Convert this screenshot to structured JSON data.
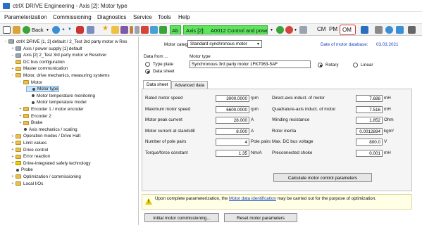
{
  "window": {
    "title": "ctrlX DRIVE Engineering - Axis [2]: Motor type"
  },
  "menu": [
    "Parameterization",
    "Commissioning",
    "Diagnostics",
    "Service",
    "Tools",
    "Help"
  ],
  "toolbar": {
    "back_label": "Back",
    "axis_label": "Axis [2]:",
    "axis_mode": "A0012 Control and power",
    "ab_label": "Ab",
    "cm_label": "CM",
    "pm_label": "PM",
    "om_label": "OM",
    "axis_color": "#5ce65c",
    "highlight_color": "#e0302b"
  },
  "tree": {
    "rows": [
      {
        "label": "ctrlX DRIVE [1, 2] default / 2_Test 3rd party motor w Res",
        "level": 0,
        "icon": "drive-icon",
        "expander": "−"
      },
      {
        "label": "Axis / power supply [1] default",
        "level": 1,
        "icon": "axis-icon",
        "expander": "+"
      },
      {
        "label": "Axis [2] 2_Test 3rd party motor w Resolver",
        "level": 1,
        "icon": "axis-icon",
        "expander": "−"
      },
      {
        "label": "DC bus configuration",
        "level": 2,
        "icon": "folder-icon",
        "expander": ""
      },
      {
        "label": "Master communication",
        "level": 2,
        "icon": "folder-icon",
        "expander": "+"
      },
      {
        "label": "Motor, drive mechanics, measuring systems",
        "level": 2,
        "icon": "folder-icon",
        "expander": "−"
      },
      {
        "label": "Motor",
        "level": 3,
        "icon": "folder-icon",
        "expander": "−"
      },
      {
        "label": "Motor type",
        "level": 4,
        "icon": "bullet-icon",
        "expander": "",
        "selected": true
      },
      {
        "label": "Motor temperature monitoring",
        "level": 4,
        "icon": "bullet-icon",
        "expander": ""
      },
      {
        "label": "Motor temperature model",
        "level": 4,
        "icon": "bullet-icon",
        "expander": ""
      },
      {
        "label": "Encoder 1 / motor encoder",
        "level": 3,
        "icon": "folder-icon",
        "expander": "+"
      },
      {
        "label": "Encoder 2",
        "level": 3,
        "icon": "folder-icon",
        "expander": "+"
      },
      {
        "label": "Brake",
        "level": 3,
        "icon": "folder-icon",
        "expander": "+"
      },
      {
        "label": "Axis mechanics / scaling",
        "level": 3,
        "icon": "bullet-icon",
        "expander": ""
      },
      {
        "label": "Operation modes / Drive Halt",
        "level": 2,
        "icon": "folder-icon",
        "expander": "+"
      },
      {
        "label": "Limit values",
        "level": 2,
        "icon": "folder-icon",
        "expander": "+"
      },
      {
        "label": "Drive control",
        "level": 2,
        "icon": "folder-icon",
        "expander": "+"
      },
      {
        "label": "Error reaction",
        "level": 2,
        "icon": "folder-icon",
        "expander": "+"
      },
      {
        "label": "Drive-integrated safety technology",
        "level": 2,
        "icon": "safety-icon",
        "expander": "+"
      },
      {
        "label": "Probe",
        "level": 2,
        "icon": "bullet-icon",
        "expander": ""
      },
      {
        "label": "Optimization / commissioning",
        "level": 2,
        "icon": "folder-icon",
        "expander": "+"
      },
      {
        "label": "Local I/Os",
        "level": 2,
        "icon": "folder-icon",
        "expander": "+"
      }
    ]
  },
  "panel": {
    "motor_category_label": "Motor category",
    "motor_category_value": "Standard synchronous motor",
    "db_date_label": "Date of motor database:",
    "db_date_value": "03.03.2021",
    "data_from_label": "Data from ...",
    "type_plate_label": "Type plate",
    "data_sheet_label": "Data sheet",
    "motor_type_label": "Motor type",
    "motor_type_value": "Synchronous 3rd party motor 1FK7063-5AF",
    "rotary_label": "Rotary",
    "linear_label": "Linear",
    "tabs": [
      "Data sheet",
      "Advanced data"
    ],
    "left_params": [
      {
        "label": "Rated motor speed",
        "value": "3000.0000",
        "unit": "rpm"
      },
      {
        "label": "Maximum motor speed",
        "value": "6600.0000",
        "unit": "rpm"
      },
      {
        "label": "Motor peak current",
        "value": "28.000",
        "unit": "A"
      },
      {
        "label": "Motor current at standstill",
        "value": "8.000",
        "unit": "A"
      },
      {
        "label": "Number of pole pairs",
        "value": "4",
        "unit": "Pole pairs"
      },
      {
        "label": "Torque/force constant",
        "value": "1.35",
        "unit": "Nm/A"
      }
    ],
    "right_params": [
      {
        "label": "Direct-axis induct. of motor",
        "value": "7.688",
        "unit": "mH"
      },
      {
        "label": "Quadrature-axis induct. of motor",
        "value": "7.516",
        "unit": "mH"
      },
      {
        "label": "Winding resistance",
        "value": "1.852",
        "unit": "Ohm"
      },
      {
        "label": "Rotor inertia",
        "value": "0.0012894",
        "unit": "kgm²"
      },
      {
        "label": "Max. DC bus voltage",
        "value": "800.0",
        "unit": "V"
      },
      {
        "label": "Preconnected choke",
        "value": "0.001",
        "unit": "mH"
      }
    ],
    "calc_button": "Calculate motor control parameters",
    "info_text_1": "Upon complete parameterization, the",
    "info_link": "Motor data identification",
    "info_text_2": "may be carried out for the purpose of",
    "info_text_3": "optimization.",
    "initial_button": "Initial motor commissioning...",
    "reset_button": "Reset motor parameters"
  }
}
